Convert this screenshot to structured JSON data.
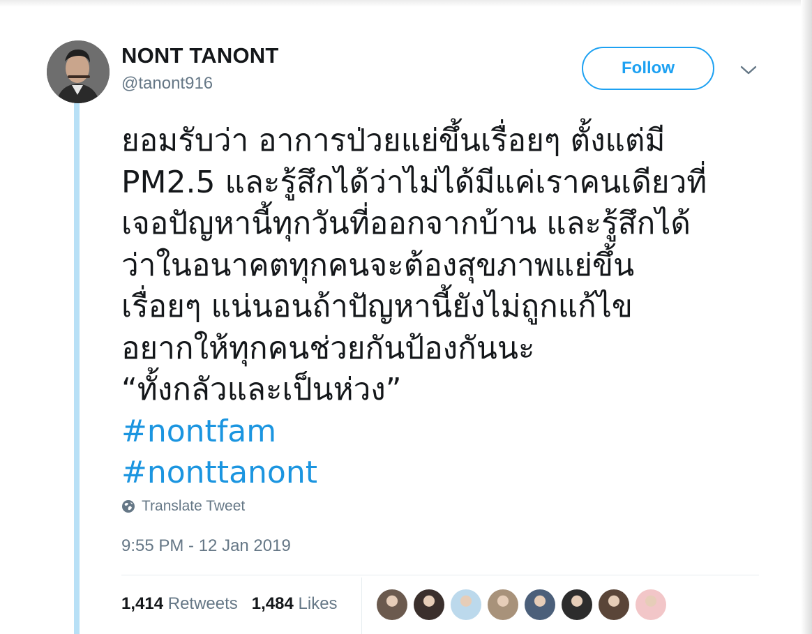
{
  "author": {
    "display_name": "NONT TANONT",
    "username": "@tanont916"
  },
  "follow_button": {
    "label": "Follow"
  },
  "tweet": {
    "lines": [
      "ยอมรับว่า อาการป่วยแย่ขึ้นเรื่อยๆ ตั้งแต่มี",
      "PM2.5 และรู้สึกได้ว่าไม่ได้มีแค่เราคนเดียวที่",
      "เจอปัญหานี้ทุกวันที่ออกจากบ้าน และรู้สึกได้",
      "ว่าในอนาคตทุกคนจะต้องสุขภาพแย่ขึ้น",
      "เรื่อยๆ แน่นอนถ้าปัญหานี้ยังไม่ถูกแก้ไข",
      "อยากให้ทุกคนช่วยกันป้องกันนะ",
      "“ทั้งกลัวและเป็นห่วง”"
    ],
    "hashtags": [
      "#nontfam",
      "#nonttanont"
    ]
  },
  "translate": {
    "label": "Translate Tweet",
    "icon": "globe-icon"
  },
  "timestamp": "9:55 PM - 12 Jan 2019",
  "stats": {
    "retweets_count": "1,414",
    "retweets_label": "Retweets",
    "likes_count": "1,484",
    "likes_label": "Likes"
  },
  "likers": [
    {
      "name": "liker-avatar-1",
      "color": "#6b5a4e"
    },
    {
      "name": "liker-avatar-2",
      "color": "#3a2f2c"
    },
    {
      "name": "liker-avatar-3",
      "color": "#bcd9ec"
    },
    {
      "name": "liker-avatar-4",
      "color": "#a8927a"
    },
    {
      "name": "liker-avatar-5",
      "color": "#4b5f7a"
    },
    {
      "name": "liker-avatar-6",
      "color": "#2c2c2c"
    },
    {
      "name": "liker-avatar-7",
      "color": "#5a4538"
    },
    {
      "name": "liker-avatar-8",
      "color": "#f2c6c8"
    }
  ],
  "colors": {
    "accent": "#1da1f2",
    "hashtag": "#1b95e0",
    "thread_line": "#b8e0f6",
    "text": "#14171a",
    "secondary": "#657786"
  }
}
